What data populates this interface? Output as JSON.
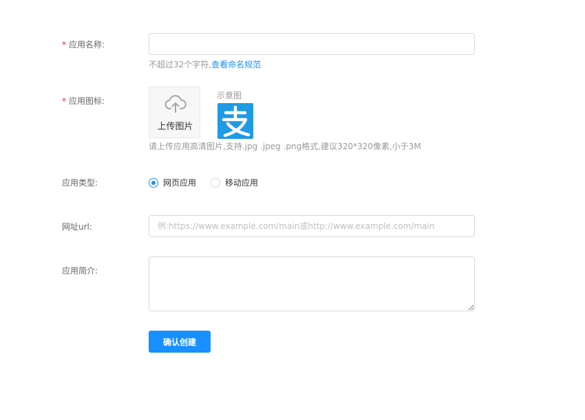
{
  "form": {
    "app_name": {
      "required_mark": "*",
      "label": "应用名称:",
      "value": "",
      "hint_text": "不超过32个字符,",
      "hint_link": "查看命名规范"
    },
    "app_icon": {
      "required_mark": "*",
      "label": "应用图标:",
      "upload_label": "上传图片",
      "upload_icon": "cloud-upload-icon",
      "example_label": "示意图",
      "example_icon": "alipay-logo-icon",
      "example_glyph": "支",
      "hint": "请上传应用高清图片,支持.jpg .jpeg .png格式,建议320*320像素,小于3M"
    },
    "app_type": {
      "label": "应用类型:",
      "options": [
        {
          "label": "网页应用",
          "selected": true
        },
        {
          "label": "移动应用",
          "selected": false
        }
      ]
    },
    "url": {
      "label": "网址url:",
      "value": "",
      "placeholder": "例:https://www.example.com/main或http://www.example.com/main"
    },
    "description": {
      "label": "应用简介:",
      "value": ""
    },
    "submit_label": "确认创建"
  },
  "colors": {
    "accent": "#1890ff",
    "required": "#f5222d",
    "example_bg": "#1f9ae5"
  }
}
